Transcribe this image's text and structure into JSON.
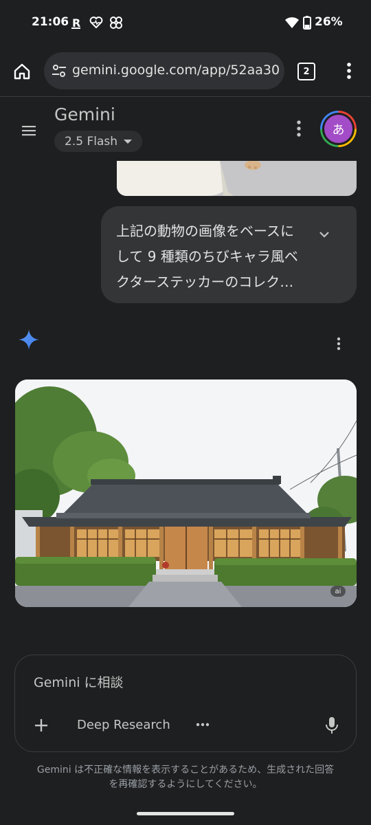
{
  "status_bar": {
    "time": "21:06",
    "battery_percent": "26%",
    "icons": [
      "rakuten-r-icon",
      "heart-monitor-icon",
      "pinwheel-app-icon",
      "wifi-icon",
      "battery-icon"
    ]
  },
  "browser": {
    "url": "gemini.google.com/app/52aa30",
    "tab_count": "2",
    "icons": [
      "home-icon",
      "site-settings-icon",
      "more-vert-icon"
    ]
  },
  "header": {
    "title": "Gemini",
    "model": "2.5 Flash",
    "avatar_initial": "あ"
  },
  "chat": {
    "user_message_lines": [
      "上記の動物の画像をベースに",
      "して 9 種類のちびキャラ風ベ",
      "クターステッカーのコレク…"
    ],
    "image_badge": "ai"
  },
  "composer": {
    "placeholder": "Gemini に相談",
    "deep_research_label": "Deep Research"
  },
  "disclaimer": {
    "line1": "Gemini は不正確な情報を表示することがあるため、生成された回答",
    "line2": "を再確認するようにしてください。"
  },
  "colors": {
    "background": "#1e1f20",
    "bubble": "#333537",
    "gemini_star": "#4c8df6",
    "avatar": "#a34cc7"
  }
}
